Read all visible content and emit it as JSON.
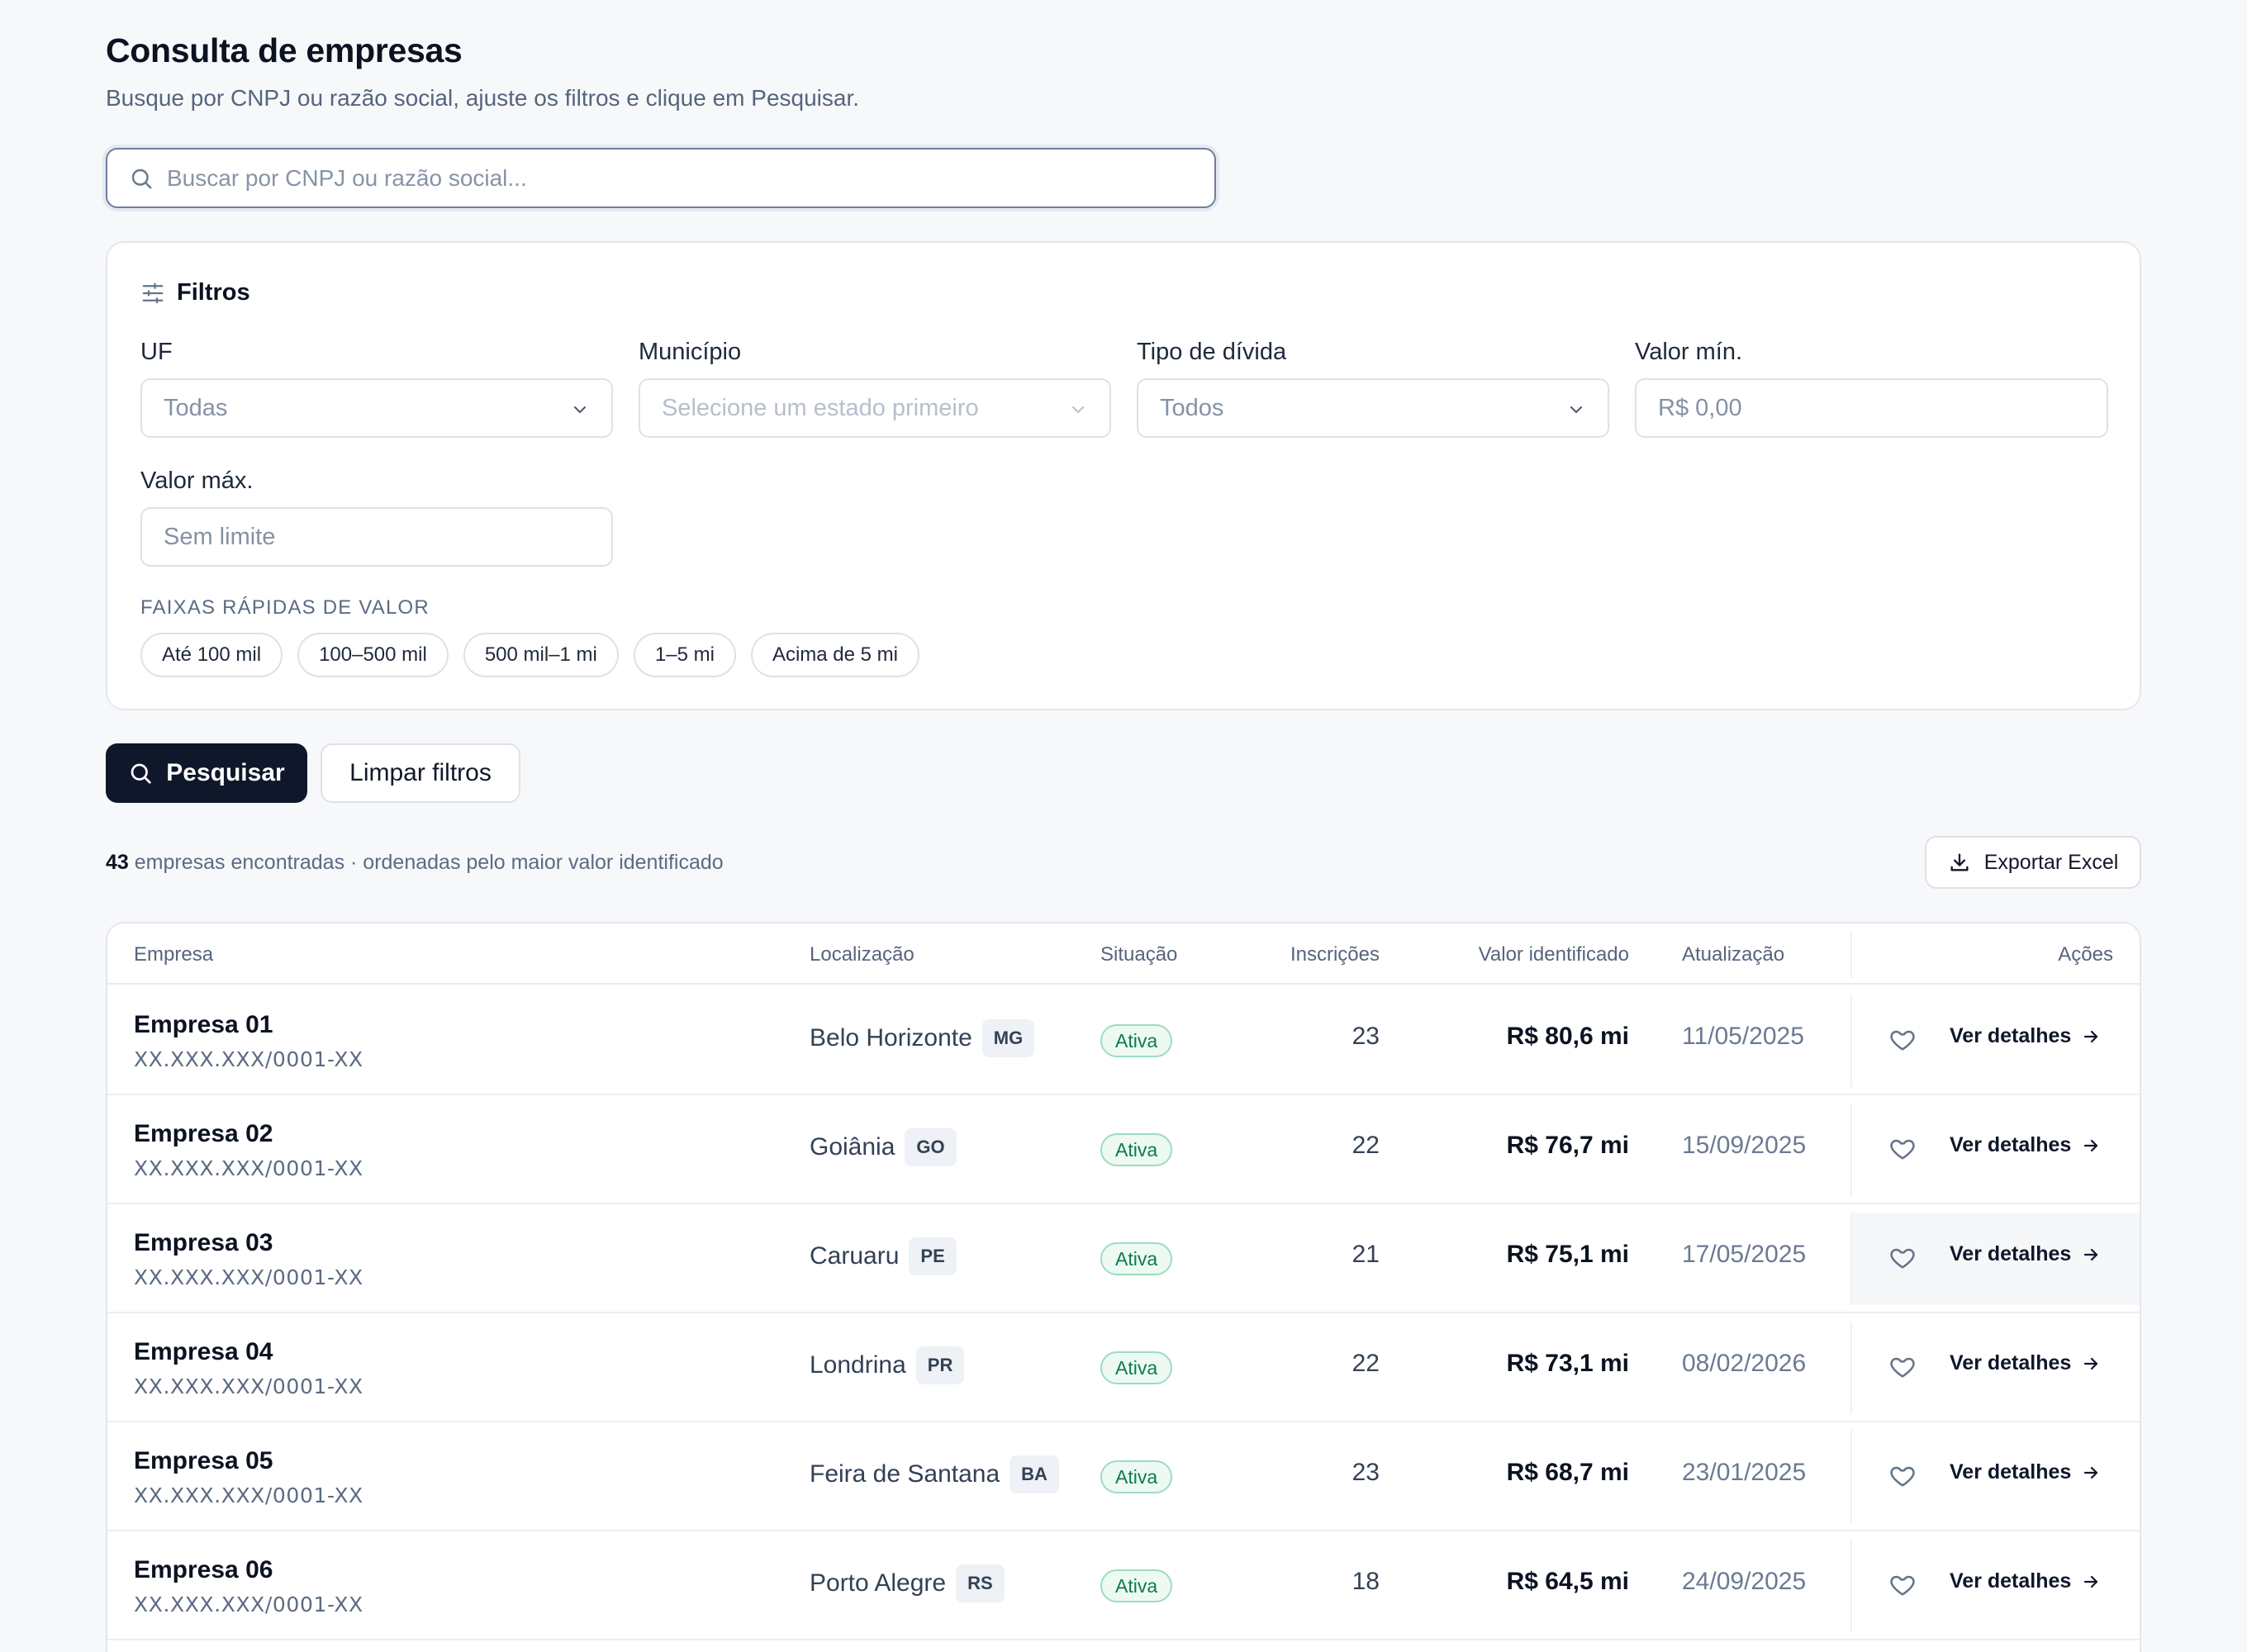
{
  "header": {
    "title": "Consulta de empresas",
    "subtitle": "Busque por CNPJ ou razão social, ajuste os filtros e clique em Pesquisar."
  },
  "search": {
    "placeholder": "Buscar por CNPJ ou razão social...",
    "value": ""
  },
  "filters": {
    "title": "Filtros",
    "uf": {
      "label": "UF",
      "value": "Todas"
    },
    "municipio": {
      "label": "Município",
      "placeholder": "Selecione um estado primeiro"
    },
    "tipo_divida": {
      "label": "Tipo de dívida",
      "value": "Todos"
    },
    "valor_min": {
      "label": "Valor mín.",
      "placeholder": "R$ 0,00"
    },
    "valor_max": {
      "label": "Valor máx.",
      "placeholder": "Sem limite"
    },
    "quick_label": "FAIXAS RÁPIDAS DE VALOR",
    "quick_ranges": [
      "Até 100 mil",
      "100–500 mil",
      "500 mil–1 mi",
      "1–5 mi",
      "Acima de 5 mi"
    ]
  },
  "actions": {
    "search_label": "Pesquisar",
    "clear_label": "Limpar filtros",
    "export_label": "Exportar Excel"
  },
  "results": {
    "count": "43",
    "text": "empresas encontradas · ordenadas pelo maior valor identificado"
  },
  "table": {
    "columns": [
      "Empresa",
      "Localização",
      "Situação",
      "Inscrições",
      "Valor identificado",
      "Atualização",
      "Ações"
    ],
    "details_label": "Ver detalhes",
    "rows": [
      {
        "name": "Empresa 01",
        "cnpj": "XX.XXX.XXX/0001-XX",
        "city": "Belo Horizonte",
        "uf": "MG",
        "status": "Ativa",
        "inscricoes": "23",
        "valor": "R$ 80,6 mi",
        "data": "11/05/2025"
      },
      {
        "name": "Empresa 02",
        "cnpj": "XX.XXX.XXX/0001-XX",
        "city": "Goiânia",
        "uf": "GO",
        "status": "Ativa",
        "inscricoes": "22",
        "valor": "R$ 76,7 mi",
        "data": "15/09/2025"
      },
      {
        "name": "Empresa 03",
        "cnpj": "XX.XXX.XXX/0001-XX",
        "city": "Caruaru",
        "uf": "PE",
        "status": "Ativa",
        "inscricoes": "21",
        "valor": "R$ 75,1 mi",
        "data": "17/05/2025"
      },
      {
        "name": "Empresa 04",
        "cnpj": "XX.XXX.XXX/0001-XX",
        "city": "Londrina",
        "uf": "PR",
        "status": "Ativa",
        "inscricoes": "22",
        "valor": "R$ 73,1 mi",
        "data": "08/02/2026"
      },
      {
        "name": "Empresa 05",
        "cnpj": "XX.XXX.XXX/0001-XX",
        "city": "Feira de Santana",
        "uf": "BA",
        "status": "Ativa",
        "inscricoes": "23",
        "valor": "R$ 68,7 mi",
        "data": "23/01/2025"
      },
      {
        "name": "Empresa 06",
        "cnpj": "XX.XXX.XXX/0001-XX",
        "city": "Porto Alegre",
        "uf": "RS",
        "status": "Ativa",
        "inscricoes": "18",
        "valor": "R$ 64,5 mi",
        "data": "24/09/2025"
      }
    ]
  }
}
